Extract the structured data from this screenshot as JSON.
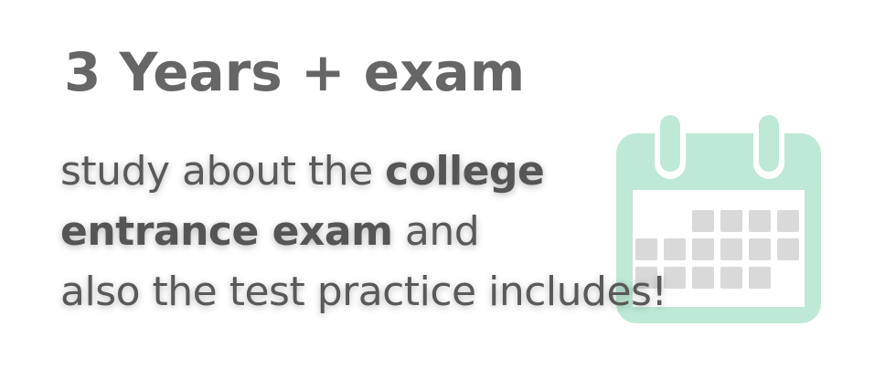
{
  "headline": {
    "text": "3 Years + exam"
  },
  "body": {
    "line1_plain": "study about the ",
    "line1_bold": "college",
    "line2_bold": "entrance exam",
    "line2_plain": " and",
    "line3_plain": "also the test practice includes!"
  },
  "calendar": {
    "icon": "calendar-icon",
    "frame_color": "#bde9d6",
    "day_color": "#d9d9d9",
    "rows": [
      [
        false,
        false,
        true,
        true,
        true,
        true
      ],
      [
        true,
        true,
        true,
        true,
        true,
        true
      ],
      [
        true,
        true,
        true,
        true,
        true,
        false
      ]
    ]
  }
}
